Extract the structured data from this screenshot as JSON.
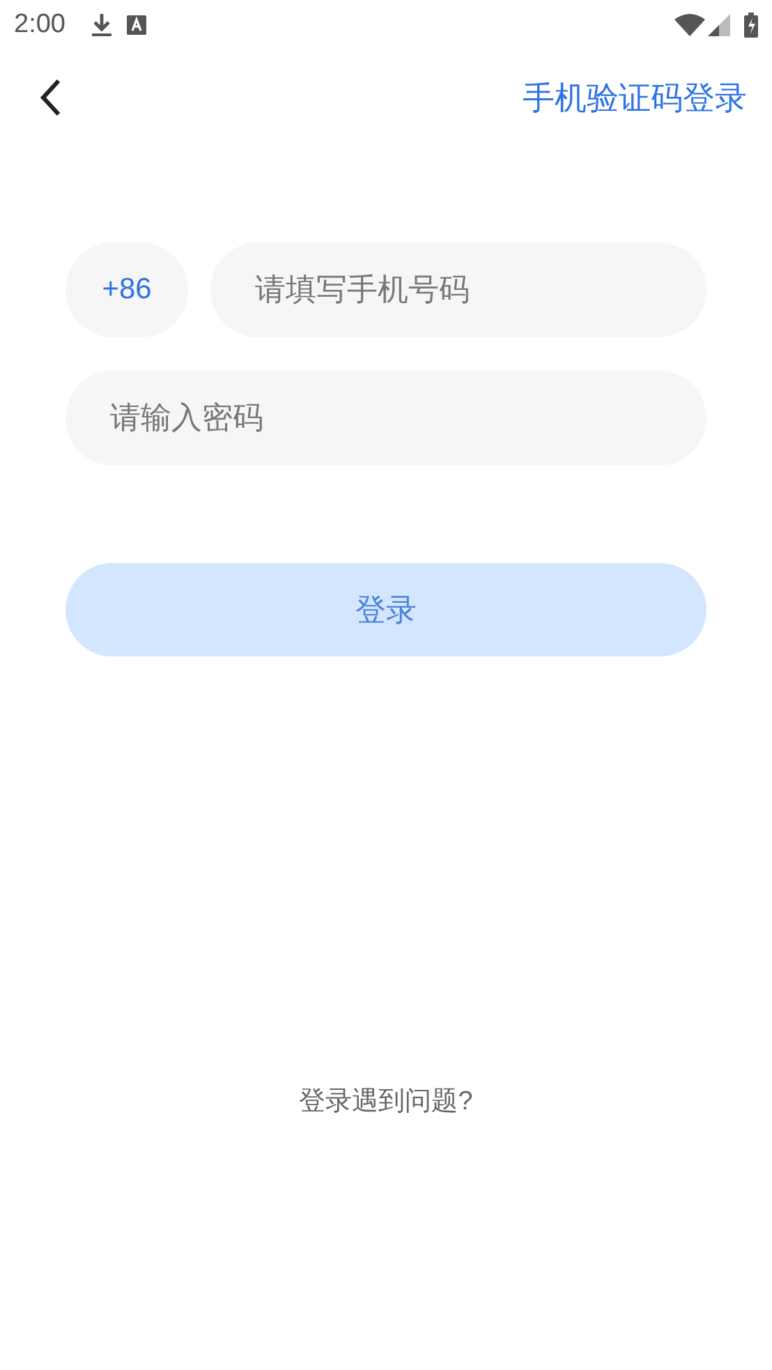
{
  "status_bar": {
    "time": "2:00"
  },
  "header": {
    "switch_link": "手机验证码登录"
  },
  "form": {
    "country_code": "+86",
    "phone": {
      "placeholder": "请填写手机号码"
    },
    "password": {
      "placeholder": "请输入密码"
    }
  },
  "login_button": {
    "label": "登录",
    "disabled": true
  },
  "help_link": "登录遇到问题?"
}
